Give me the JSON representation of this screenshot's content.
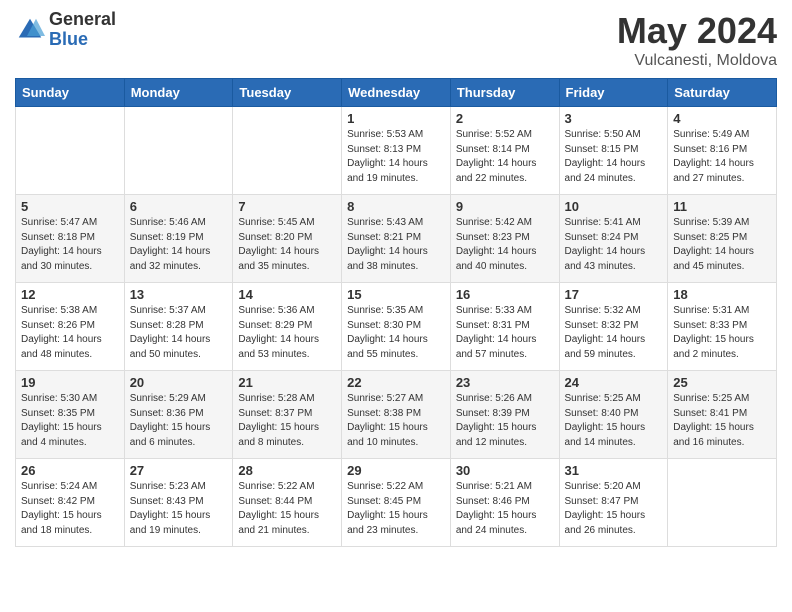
{
  "header": {
    "logo_general": "General",
    "logo_blue": "Blue",
    "title": "May 2024",
    "subtitle": "Vulcanesti, Moldova"
  },
  "days_of_week": [
    "Sunday",
    "Monday",
    "Tuesday",
    "Wednesday",
    "Thursday",
    "Friday",
    "Saturday"
  ],
  "weeks": [
    [
      {
        "day": "",
        "sunrise": "",
        "sunset": "",
        "daylight": ""
      },
      {
        "day": "",
        "sunrise": "",
        "sunset": "",
        "daylight": ""
      },
      {
        "day": "",
        "sunrise": "",
        "sunset": "",
        "daylight": ""
      },
      {
        "day": "1",
        "sunrise": "Sunrise: 5:53 AM",
        "sunset": "Sunset: 8:13 PM",
        "daylight": "Daylight: 14 hours and 19 minutes."
      },
      {
        "day": "2",
        "sunrise": "Sunrise: 5:52 AM",
        "sunset": "Sunset: 8:14 PM",
        "daylight": "Daylight: 14 hours and 22 minutes."
      },
      {
        "day": "3",
        "sunrise": "Sunrise: 5:50 AM",
        "sunset": "Sunset: 8:15 PM",
        "daylight": "Daylight: 14 hours and 24 minutes."
      },
      {
        "day": "4",
        "sunrise": "Sunrise: 5:49 AM",
        "sunset": "Sunset: 8:16 PM",
        "daylight": "Daylight: 14 hours and 27 minutes."
      }
    ],
    [
      {
        "day": "5",
        "sunrise": "Sunrise: 5:47 AM",
        "sunset": "Sunset: 8:18 PM",
        "daylight": "Daylight: 14 hours and 30 minutes."
      },
      {
        "day": "6",
        "sunrise": "Sunrise: 5:46 AM",
        "sunset": "Sunset: 8:19 PM",
        "daylight": "Daylight: 14 hours and 32 minutes."
      },
      {
        "day": "7",
        "sunrise": "Sunrise: 5:45 AM",
        "sunset": "Sunset: 8:20 PM",
        "daylight": "Daylight: 14 hours and 35 minutes."
      },
      {
        "day": "8",
        "sunrise": "Sunrise: 5:43 AM",
        "sunset": "Sunset: 8:21 PM",
        "daylight": "Daylight: 14 hours and 38 minutes."
      },
      {
        "day": "9",
        "sunrise": "Sunrise: 5:42 AM",
        "sunset": "Sunset: 8:23 PM",
        "daylight": "Daylight: 14 hours and 40 minutes."
      },
      {
        "day": "10",
        "sunrise": "Sunrise: 5:41 AM",
        "sunset": "Sunset: 8:24 PM",
        "daylight": "Daylight: 14 hours and 43 minutes."
      },
      {
        "day": "11",
        "sunrise": "Sunrise: 5:39 AM",
        "sunset": "Sunset: 8:25 PM",
        "daylight": "Daylight: 14 hours and 45 minutes."
      }
    ],
    [
      {
        "day": "12",
        "sunrise": "Sunrise: 5:38 AM",
        "sunset": "Sunset: 8:26 PM",
        "daylight": "Daylight: 14 hours and 48 minutes."
      },
      {
        "day": "13",
        "sunrise": "Sunrise: 5:37 AM",
        "sunset": "Sunset: 8:28 PM",
        "daylight": "Daylight: 14 hours and 50 minutes."
      },
      {
        "day": "14",
        "sunrise": "Sunrise: 5:36 AM",
        "sunset": "Sunset: 8:29 PM",
        "daylight": "Daylight: 14 hours and 53 minutes."
      },
      {
        "day": "15",
        "sunrise": "Sunrise: 5:35 AM",
        "sunset": "Sunset: 8:30 PM",
        "daylight": "Daylight: 14 hours and 55 minutes."
      },
      {
        "day": "16",
        "sunrise": "Sunrise: 5:33 AM",
        "sunset": "Sunset: 8:31 PM",
        "daylight": "Daylight: 14 hours and 57 minutes."
      },
      {
        "day": "17",
        "sunrise": "Sunrise: 5:32 AM",
        "sunset": "Sunset: 8:32 PM",
        "daylight": "Daylight: 14 hours and 59 minutes."
      },
      {
        "day": "18",
        "sunrise": "Sunrise: 5:31 AM",
        "sunset": "Sunset: 8:33 PM",
        "daylight": "Daylight: 15 hours and 2 minutes."
      }
    ],
    [
      {
        "day": "19",
        "sunrise": "Sunrise: 5:30 AM",
        "sunset": "Sunset: 8:35 PM",
        "daylight": "Daylight: 15 hours and 4 minutes."
      },
      {
        "day": "20",
        "sunrise": "Sunrise: 5:29 AM",
        "sunset": "Sunset: 8:36 PM",
        "daylight": "Daylight: 15 hours and 6 minutes."
      },
      {
        "day": "21",
        "sunrise": "Sunrise: 5:28 AM",
        "sunset": "Sunset: 8:37 PM",
        "daylight": "Daylight: 15 hours and 8 minutes."
      },
      {
        "day": "22",
        "sunrise": "Sunrise: 5:27 AM",
        "sunset": "Sunset: 8:38 PM",
        "daylight": "Daylight: 15 hours and 10 minutes."
      },
      {
        "day": "23",
        "sunrise": "Sunrise: 5:26 AM",
        "sunset": "Sunset: 8:39 PM",
        "daylight": "Daylight: 15 hours and 12 minutes."
      },
      {
        "day": "24",
        "sunrise": "Sunrise: 5:25 AM",
        "sunset": "Sunset: 8:40 PM",
        "daylight": "Daylight: 15 hours and 14 minutes."
      },
      {
        "day": "25",
        "sunrise": "Sunrise: 5:25 AM",
        "sunset": "Sunset: 8:41 PM",
        "daylight": "Daylight: 15 hours and 16 minutes."
      }
    ],
    [
      {
        "day": "26",
        "sunrise": "Sunrise: 5:24 AM",
        "sunset": "Sunset: 8:42 PM",
        "daylight": "Daylight: 15 hours and 18 minutes."
      },
      {
        "day": "27",
        "sunrise": "Sunrise: 5:23 AM",
        "sunset": "Sunset: 8:43 PM",
        "daylight": "Daylight: 15 hours and 19 minutes."
      },
      {
        "day": "28",
        "sunrise": "Sunrise: 5:22 AM",
        "sunset": "Sunset: 8:44 PM",
        "daylight": "Daylight: 15 hours and 21 minutes."
      },
      {
        "day": "29",
        "sunrise": "Sunrise: 5:22 AM",
        "sunset": "Sunset: 8:45 PM",
        "daylight": "Daylight: 15 hours and 23 minutes."
      },
      {
        "day": "30",
        "sunrise": "Sunrise: 5:21 AM",
        "sunset": "Sunset: 8:46 PM",
        "daylight": "Daylight: 15 hours and 24 minutes."
      },
      {
        "day": "31",
        "sunrise": "Sunrise: 5:20 AM",
        "sunset": "Sunset: 8:47 PM",
        "daylight": "Daylight: 15 hours and 26 minutes."
      },
      {
        "day": "",
        "sunrise": "",
        "sunset": "",
        "daylight": ""
      }
    ]
  ]
}
